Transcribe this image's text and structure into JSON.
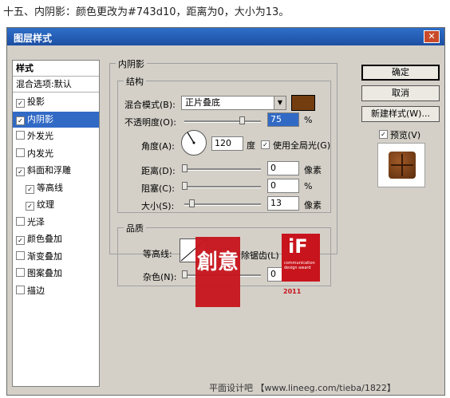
{
  "caption": "十五、内阴影：颜色更改为#743d10，距离为0，大小为13。",
  "dialog": {
    "title": "图层样式",
    "close_label": "✕"
  },
  "styles_panel": {
    "header": "样式",
    "blend_options": "混合选项:默认",
    "items": [
      {
        "label": "投影",
        "checked": true
      },
      {
        "label": "内阴影",
        "checked": true,
        "selected": true
      },
      {
        "label": "外发光",
        "checked": false
      },
      {
        "label": "内发光",
        "checked": false
      },
      {
        "label": "斜面和浮雕",
        "checked": true
      },
      {
        "label": "等高线",
        "checked": true,
        "indent": true
      },
      {
        "label": "纹理",
        "checked": true,
        "indent": true
      },
      {
        "label": "光泽",
        "checked": false
      },
      {
        "label": "颜色叠加",
        "checked": true
      },
      {
        "label": "渐变叠加",
        "checked": false
      },
      {
        "label": "图案叠加",
        "checked": false
      },
      {
        "label": "描边",
        "checked": false
      }
    ]
  },
  "inner_shadow": {
    "section_title": "内阴影",
    "structure_title": "结构",
    "blend_mode_label": "混合模式(B):",
    "blend_mode_value": "正片叠底",
    "color": "#743d10",
    "opacity_label": "不透明度(O):",
    "opacity_value": "75",
    "opacity_unit": "%",
    "opacity_level": 0.75,
    "angle_label": "角度(A):",
    "angle_value": "120",
    "angle_unit": "度",
    "global_light_label": "使用全局光(G)",
    "global_light_checked": true,
    "distance_label": "距离(D):",
    "distance_value": "0",
    "distance_unit": "像素",
    "choke_label": "阻塞(C):",
    "choke_value": "0",
    "choke_unit": "%",
    "size_label": "大小(S):",
    "size_value": "13",
    "size_unit": "像素"
  },
  "quality": {
    "title": "品质",
    "contour_label": "等高线:",
    "antialias_label": "消除锯齿(L)",
    "noise_label": "杂色(N):",
    "noise_value": "0",
    "noise_unit": "%"
  },
  "buttons": {
    "ok": "确定",
    "cancel": "取消",
    "new_style": "新建样式(W)...",
    "preview_label": "预览(V)",
    "preview_checked": true
  },
  "overlay": {
    "stamp_text": "創意",
    "award_logo": "iF",
    "award_text": "communication design award",
    "award_year": "2011"
  },
  "footer_watermark": "平面设计吧 【www.lineeg.com/tieba/1822】"
}
